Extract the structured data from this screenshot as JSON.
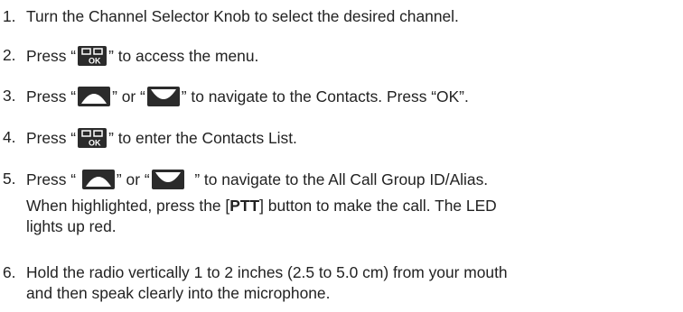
{
  "steps": [
    {
      "number": "1.",
      "text": "Turn the Channel Selector Knob to select the desired channel."
    },
    {
      "number": "2.",
      "pre": "Press “",
      "icon": "menu-ok-button-icon",
      "icon_label": "OK",
      "post": "” to access the menu."
    },
    {
      "number": "3.",
      "pre": "Press “",
      "icon1": "up-arrow-button-icon",
      "mid": "” or “",
      "icon2": "down-arrow-button-icon",
      "post": "” to navigate to the Contacts. Press “OK”."
    },
    {
      "number": "4.",
      "pre": "Press “",
      "icon": "menu-ok-button-icon",
      "icon_label": "OK",
      "post": "” to enter the Contacts List."
    },
    {
      "number": "5.",
      "pre": "Press “",
      "icon1": "up-arrow-button-icon",
      "mid": "” or “",
      "icon2": "down-arrow-button-icon",
      "post": "” to navigate to the All Call Group ID/Alias.",
      "line2_pre": "When highlighted, press the [",
      "line2_bold": "PTT",
      "line2_post": "] button to make the call. The LED",
      "line3": "lights up red."
    },
    {
      "number": "6.",
      "line1": "Hold the radio vertically 1 to 2 inches (2.5 to 5.0 cm) from your mouth",
      "line2": "and then speak clearly into the microphone."
    }
  ],
  "colors": {
    "text": "#222222",
    "icon_fill": "#2b2b2b",
    "icon_text": "#ffffff"
  }
}
